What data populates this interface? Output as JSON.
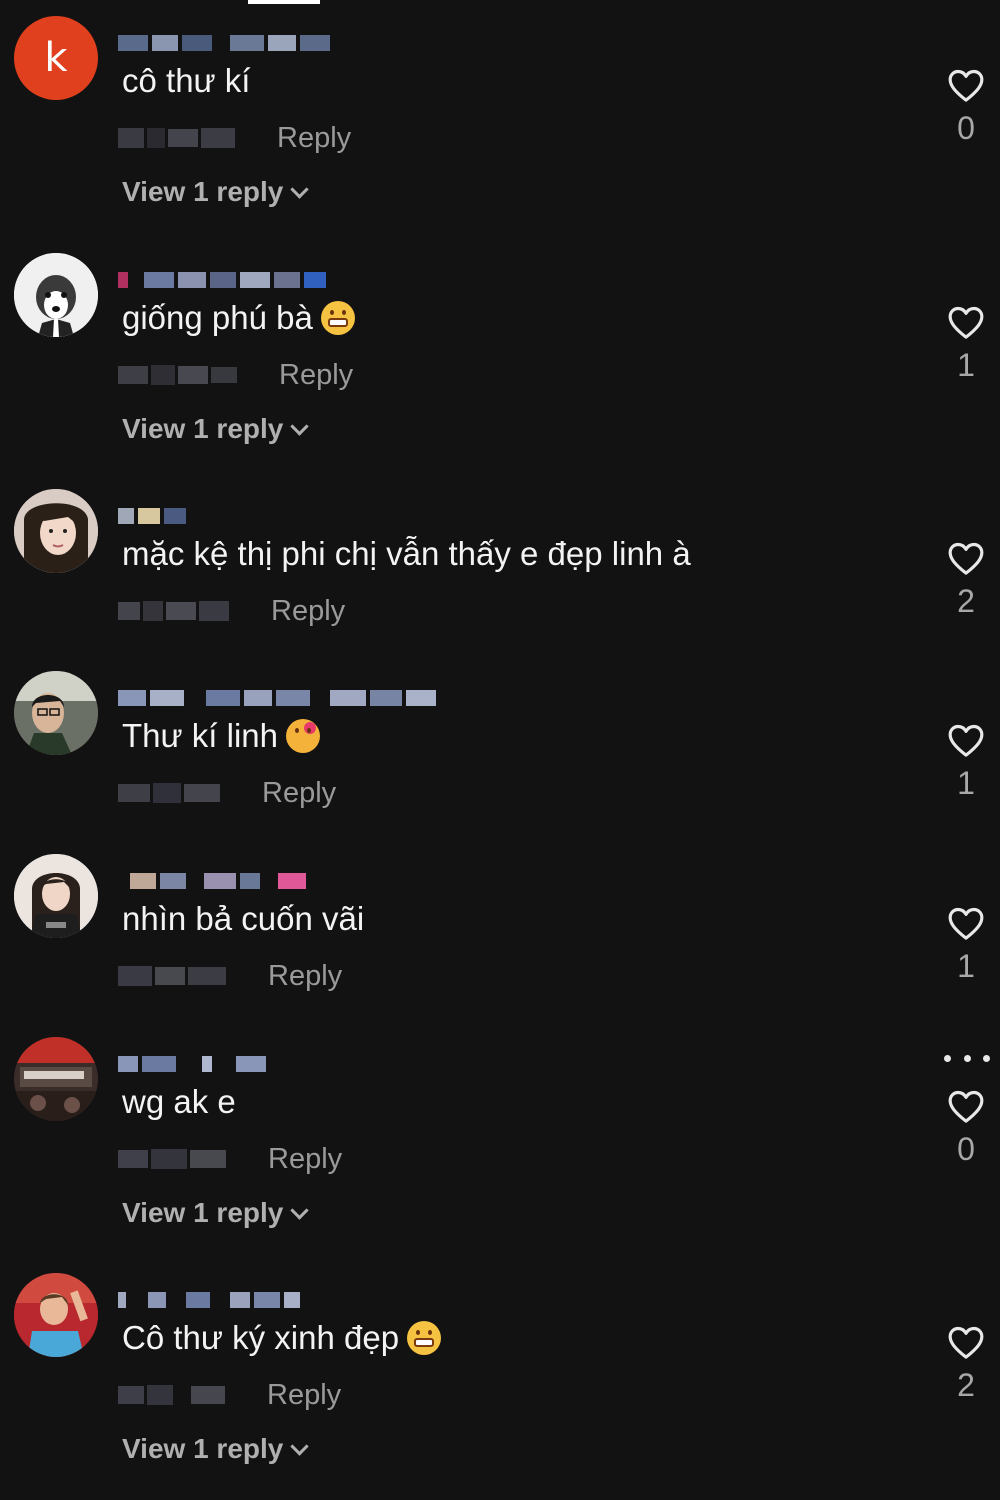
{
  "labels": {
    "reply": "Reply",
    "view_replies": "View 1 reply"
  },
  "colors": {
    "background": "#121212",
    "text_primary": "#f3f3f3",
    "text_secondary": "#9a9a9a",
    "avatar_letter_bg": "#e0401d"
  },
  "comments": [
    {
      "avatar_letter": "k",
      "text": "cô thư kí",
      "emoji": "",
      "likes": "0",
      "has_view_replies": true
    },
    {
      "avatar_letter": "",
      "text": "giống phú bà",
      "emoji": "grinning-face",
      "likes": "1",
      "has_view_replies": true
    },
    {
      "avatar_letter": "",
      "text": "mặc kệ thị phi chị vẫn thấy e đẹp linh à",
      "emoji": "",
      "likes": "2",
      "has_view_replies": false
    },
    {
      "avatar_letter": "",
      "text": "Thư kí linh",
      "emoji": "smiling-face-with-hearts",
      "likes": "1",
      "has_view_replies": false
    },
    {
      "avatar_letter": "",
      "text": "nhìn bả cuốn vãi",
      "emoji": "",
      "likes": "1",
      "has_view_replies": false
    },
    {
      "avatar_letter": "",
      "text": "wg ak e",
      "emoji": "",
      "likes": "0",
      "has_view_replies": true,
      "has_more_menu": true
    },
    {
      "avatar_letter": "",
      "text": "Cô thư ký xinh đẹp",
      "emoji": "grinning-face",
      "likes": "2",
      "has_view_replies": true
    }
  ]
}
